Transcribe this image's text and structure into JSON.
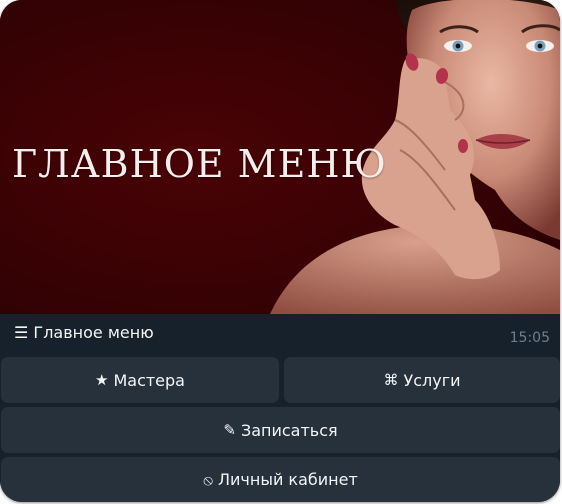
{
  "banner": {
    "title": "ГЛАВНОЕ МЕНЮ"
  },
  "message": {
    "text": "☰ Главное меню",
    "time": "15:05"
  },
  "keyboard": {
    "buttons": [
      {
        "icon": "★",
        "label": "Мастера"
      },
      {
        "icon": "⌘",
        "label": "Услуги"
      },
      {
        "icon": "✎",
        "label": "Записаться"
      },
      {
        "icon": "⦸",
        "label": "Личный кабинет"
      }
    ]
  },
  "colors": {
    "banner_bg": "#3a0204",
    "message_bg": "#17212b",
    "button_bg": "#26313c",
    "time_text": "#6d7f8f"
  }
}
